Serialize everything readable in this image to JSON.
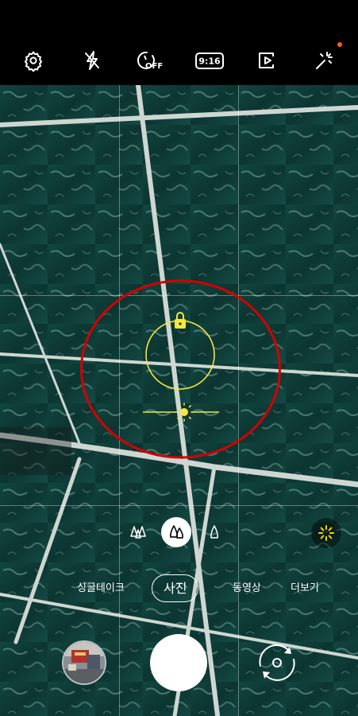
{
  "topbar": {
    "settings_icon": "gear-icon",
    "flash_icon": "flash-off-icon",
    "timer_icon": "timer-off-icon",
    "timer_label": "OFF",
    "ratio_label": "9:16",
    "motion_icon": "motion-photo-icon",
    "effects_icon": "sparkle-icon",
    "accent_color": "#ff5a1f"
  },
  "viewfinder": {
    "focus_color": "#f5e642",
    "annotation_color": "#d40000"
  },
  "lens": {
    "options": [
      "ultra-wide",
      "wide",
      "telephoto"
    ],
    "selected": "wide"
  },
  "modes": {
    "items": [
      "싱글테이크",
      "사진",
      "동영상",
      "더보기"
    ],
    "selected": "사진"
  },
  "controls": {
    "gallery_icon": "gallery-thumbnail",
    "shutter_icon": "shutter-button",
    "switch_icon": "switch-camera-icon"
  }
}
